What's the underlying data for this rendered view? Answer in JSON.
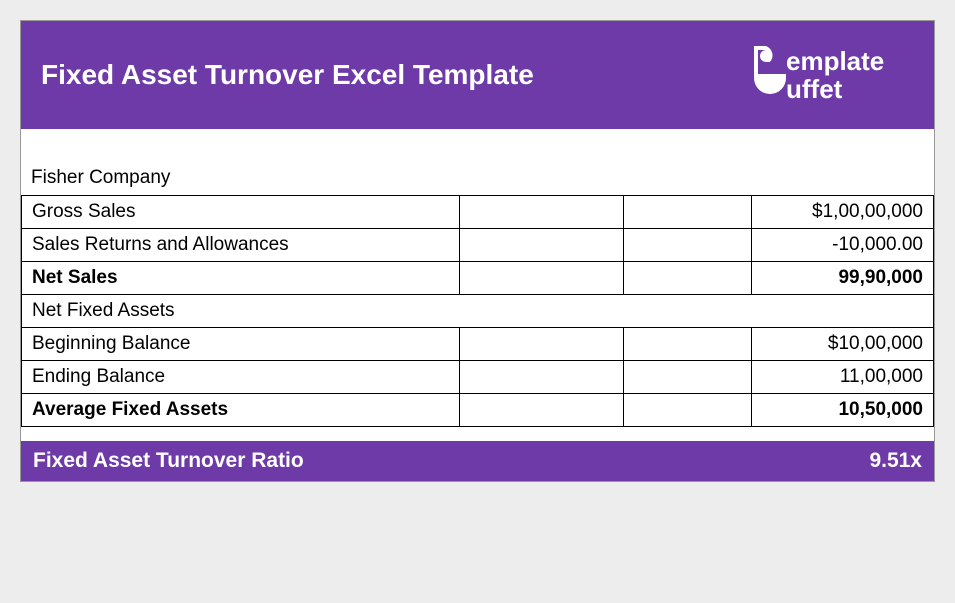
{
  "header": {
    "title": "Fixed Asset Turnover Excel Template",
    "logo_text_top": "emplate",
    "logo_text_bottom": "uffet"
  },
  "company": "Fisher Company",
  "rows": {
    "gross_sales": {
      "label": "Gross Sales",
      "value": "$1,00,00,000"
    },
    "returns": {
      "label": "Sales Returns and Allowances",
      "value": "-10,000.00"
    },
    "net_sales": {
      "label": "Net Sales",
      "value": "99,90,000"
    },
    "net_fixed_assets": {
      "label": "Net Fixed Assets"
    },
    "beginning": {
      "label": "Beginning Balance",
      "value": "$10,00,000"
    },
    "ending": {
      "label": "Ending Balance",
      "value": "11,00,000"
    },
    "average": {
      "label": "Average Fixed Assets",
      "value": "10,50,000"
    }
  },
  "footer": {
    "label": "Fixed Asset Turnover Ratio",
    "value": "9.51x"
  }
}
